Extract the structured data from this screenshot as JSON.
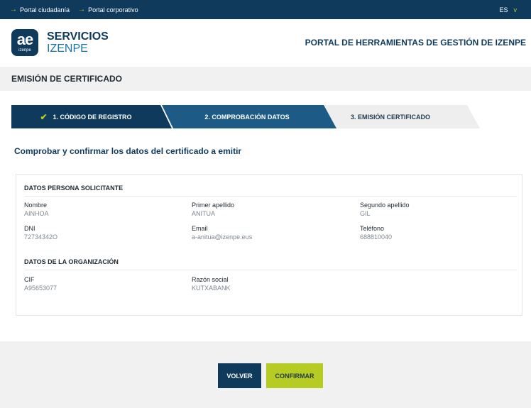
{
  "topbar": {
    "links": [
      {
        "label": "Portal ciudadanía"
      },
      {
        "label": "Portal corporativo"
      }
    ],
    "language": "ES"
  },
  "header": {
    "logo_letters": "ae",
    "logo_sub": "izenpe",
    "brand_line1": "SERVICIOS",
    "brand_line2": "IZENPE",
    "portal_title": "PORTAL DE HERRAMIENTAS DE GESTIÓN DE IZENPE"
  },
  "page": {
    "title": "EMISIÓN DE CERTIFICADO",
    "subtitle": "Comprobar y confirmar los datos del certificado a emitir"
  },
  "steps": [
    {
      "label": "1. CÓDIGO DE REGISTRO",
      "state": "completed"
    },
    {
      "label": "2. COMPROBACIÓN DATOS",
      "state": "active"
    },
    {
      "label": "3. EMISIÓN CERTIFICADO",
      "state": "pending"
    }
  ],
  "solicitante": {
    "section_title": "DATOS PERSONA SOLICITANTE",
    "fields": [
      {
        "label": "Nombre",
        "value": "AINHOA"
      },
      {
        "label": "Primer apellido",
        "value": "ANITUA"
      },
      {
        "label": "Segundo apellido",
        "value": "GIL"
      },
      {
        "label": "DNI",
        "value": "72734342O"
      },
      {
        "label": "Email",
        "value": "a-anitua@izenpe.eus"
      },
      {
        "label": "Teléfono",
        "value": "688810040"
      }
    ]
  },
  "organizacion": {
    "section_title": "DATOS DE LA ORGANIZACIÓN",
    "fields": [
      {
        "label": "CIF",
        "value": "A95653077"
      },
      {
        "label": "Razón social",
        "value": "KUTXABANK"
      }
    ]
  },
  "buttons": {
    "volver": "VOLVER",
    "confirmar": "CONFIRMAR"
  },
  "colors": {
    "navy": "#0f3a5c",
    "accent_green": "#b6cc22",
    "step_active": "#1d5b86",
    "band_gray": "#f1f1f1"
  }
}
